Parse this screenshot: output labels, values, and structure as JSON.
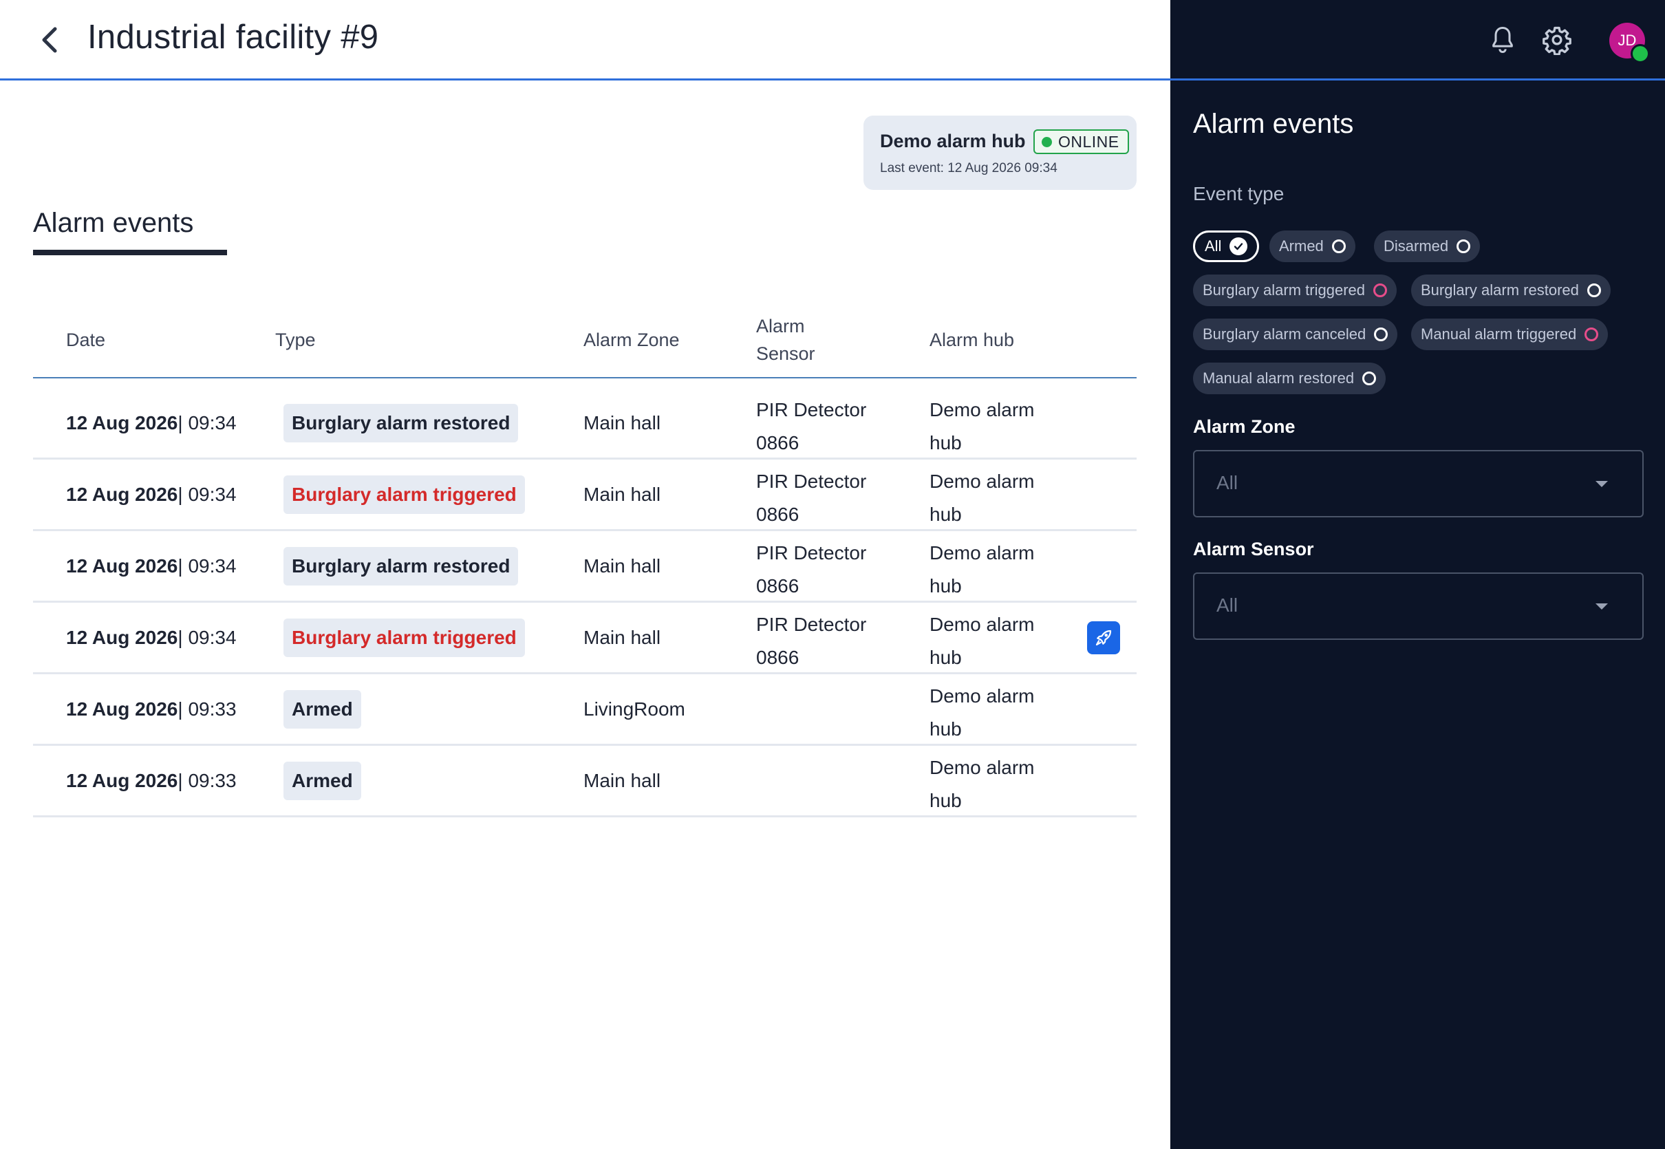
{
  "header": {
    "title": "Industrial facility #9"
  },
  "hub_card": {
    "name": "Demo alarm hub",
    "status": "ONLINE",
    "last_event": "Last event: 12 Aug 2026 09:34"
  },
  "section": {
    "title": "Alarm events"
  },
  "table": {
    "columns": [
      "Date",
      "Type",
      "Alarm Zone",
      "Alarm Sensor",
      "Alarm hub"
    ],
    "rows": [
      {
        "date": "12 Aug 2026",
        "time": " | 09:34",
        "type": "Burglary alarm restored",
        "zone": "Main hall",
        "sensor": "PIR Detector 0866",
        "hub": "Demo alarm hub"
      },
      {
        "date": "12 Aug 2026",
        "time": " | 09:34",
        "type": "Burglary alarm triggered",
        "zone": "Main hall",
        "sensor": "PIR Detector 0866",
        "hub": "Demo alarm hub"
      },
      {
        "date": "12 Aug 2026",
        "time": " | 09:34",
        "type": "Burglary alarm restored",
        "zone": "Main hall",
        "sensor": "PIR Detector 0866",
        "hub": "Demo alarm hub"
      },
      {
        "date": "12 Aug 2026",
        "time": " | 09:34",
        "type": "Burglary alarm triggered",
        "zone": "Main hall",
        "sensor": "PIR Detector 0866",
        "hub": "Demo alarm hub"
      },
      {
        "date": "12 Aug 2026",
        "time": " | 09:33",
        "type": "Armed",
        "zone": "LivingRoom",
        "sensor": "",
        "hub": "Demo alarm hub"
      },
      {
        "date": "12 Aug 2026",
        "time": " | 09:33",
        "type": "Armed",
        "zone": "Main hall",
        "sensor": "",
        "hub": "Demo alarm hub"
      }
    ]
  },
  "panel": {
    "title": "Alarm events",
    "event_type_label": "Event type",
    "chips": [
      {
        "label": "All"
      },
      {
        "label": "Armed"
      },
      {
        "label": "Disarmed"
      },
      {
        "label": "Burglary alarm triggered"
      },
      {
        "label": "Burglary alarm restored"
      },
      {
        "label": "Burglary alarm canceled"
      },
      {
        "label": "Manual alarm triggered"
      },
      {
        "label": "Manual alarm restored"
      }
    ],
    "zone_label": "Alarm Zone",
    "zone_value": "All",
    "sensor_label": "Alarm Sensor",
    "sensor_value": "All"
  },
  "user": {
    "initials": "JD"
  },
  "colors": {
    "accent": "#2f6fdb",
    "panel_bg": "#0c1427",
    "alert_text": "#d42a2a",
    "online_green": "#22b04f",
    "avatar": "#c2198f",
    "action_button": "#1a66e6"
  }
}
